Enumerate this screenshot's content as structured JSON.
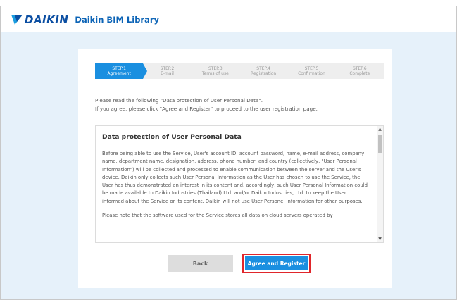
{
  "header": {
    "logo_text": "DAIKIN",
    "app_title": "Daikin BIM Library",
    "brand_color": "#0b4ea2",
    "logo_accent_color": "#1a9de0"
  },
  "steps": [
    {
      "number": "STEP.1",
      "label": "Agreement",
      "active": true
    },
    {
      "number": "STEP.2",
      "label": "E-mail",
      "active": false
    },
    {
      "number": "STEP.3",
      "label": "Terms of use",
      "active": false
    },
    {
      "number": "STEP.4",
      "label": "Registration",
      "active": false
    },
    {
      "number": "STEP.5",
      "label": "Confirmation",
      "active": false
    },
    {
      "number": "STEP.6",
      "label": "Complete",
      "active": false
    }
  ],
  "intro": {
    "line1": "Please read the following \"Data protection of User Personal Data\".",
    "line2": "If you agree, please click \"Agree and Register\" to proceed to the user registration page."
  },
  "policy": {
    "title": "Data protection of User Personal Data",
    "paragraph1": "Before being able to use the Service, User's account ID, account password, name, e-mail address, company name, department name, designation, address, phone number, and country (collectively, \"User Personal Information\") will be collected and processed to enable communication between the server and the User's device. Daikin only collects such User Personal Information as the User has chosen to use the Service, the User has thus demonstrated an interest in its content and, accordingly, such User Personal Information could be made available to Daikin Industries (Thailand) Ltd. and/or Daikin Industries, Ltd. to keep the User informed about the Service or its content. Daikin will not use User Personel Information for other purposes.",
    "paragraph2": "Please note that the software used for the Service stores all data on cloud servers operated by"
  },
  "buttons": {
    "back": "Back",
    "agree": "Agree and Register"
  },
  "colors": {
    "accent": "#1a8fe0",
    "highlight_border": "#e0262b",
    "background": "#e6f1fa"
  }
}
